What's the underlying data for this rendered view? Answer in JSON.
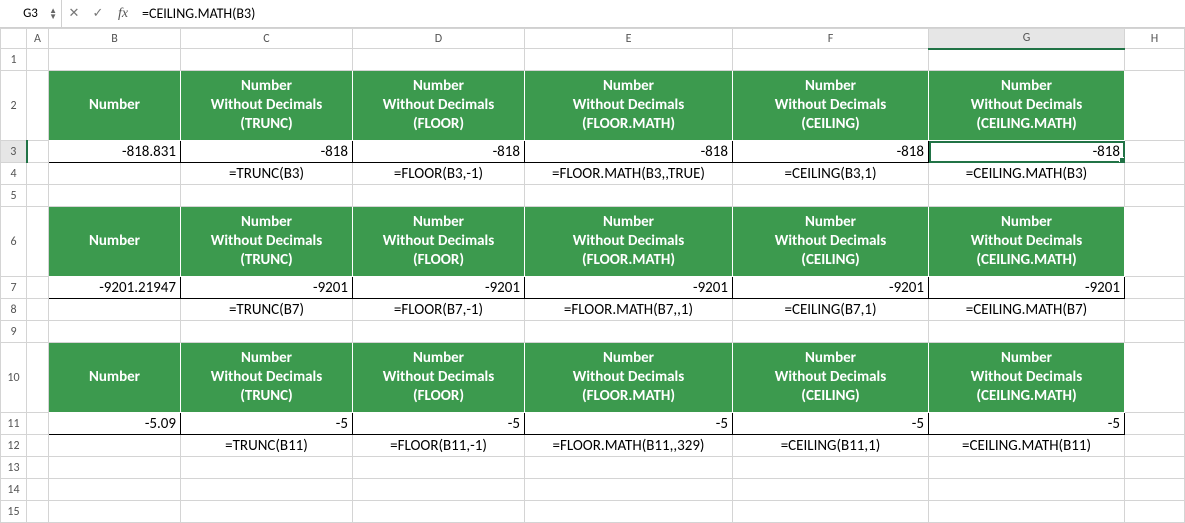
{
  "formula_bar": {
    "name_box": "G3",
    "cancel_glyph": "✕",
    "confirm_glyph": "✓",
    "fx_label": "fx",
    "formula": "=CEILING.MATH(B3)"
  },
  "columns": [
    "A",
    "B",
    "C",
    "D",
    "E",
    "F",
    "G",
    "H"
  ],
  "col_widths": {
    "rowhdr": 26,
    "A": 22,
    "B": 132,
    "C": 172,
    "D": 172,
    "E": 208,
    "F": 196,
    "G": 196,
    "H": 60
  },
  "rows": [
    "1",
    "2",
    "3",
    "4",
    "5",
    "6",
    "7",
    "8",
    "9",
    "10",
    "11",
    "12",
    "13",
    "14",
    "15"
  ],
  "selected_cell": "G3",
  "selected_col": "G",
  "selected_row": "3",
  "headers": {
    "number": "Number",
    "trunc": "Number\nWithout Decimals\n(TRUNC)",
    "floor": "Number\nWithout Decimals\n(FLOOR)",
    "floor_math": "Number\nWithout Decimals\n(FLOOR.MATH)",
    "ceiling": "Number\nWithout Decimals\n(CEILING)",
    "ceiling_math": "Number\nWithout Decimals\n(CEILING.MATH)"
  },
  "chart_data": {
    "type": "table",
    "blocks": [
      {
        "header_row": 2,
        "value_row": 3,
        "formula_row": 4,
        "number": "-818.831",
        "values": {
          "trunc": "-818",
          "floor": "-818",
          "floor_math": "-818",
          "ceiling": "-818",
          "ceiling_math": "-818"
        },
        "formulas": {
          "trunc": "=TRUNC(B3)",
          "floor": "=FLOOR(B3,-1)",
          "floor_math": "=FLOOR.MATH(B3,,TRUE)",
          "ceiling": "=CEILING(B3,1)",
          "ceiling_math": "=CEILING.MATH(B3)"
        }
      },
      {
        "header_row": 6,
        "value_row": 7,
        "formula_row": 8,
        "number": "-9201.21947",
        "values": {
          "trunc": "-9201",
          "floor": "-9201",
          "floor_math": "-9201",
          "ceiling": "-9201",
          "ceiling_math": "-9201"
        },
        "formulas": {
          "trunc": "=TRUNC(B7)",
          "floor": "=FLOOR(B7,-1)",
          "floor_math": "=FLOOR.MATH(B7,,1)",
          "ceiling": "=CEILING(B7,1)",
          "ceiling_math": "=CEILING.MATH(B7)"
        }
      },
      {
        "header_row": 10,
        "value_row": 11,
        "formula_row": 12,
        "number": "-5.09",
        "values": {
          "trunc": "-5",
          "floor": "-5",
          "floor_math": "-5",
          "ceiling": "-5",
          "ceiling_math": "-5"
        },
        "formulas": {
          "trunc": "=TRUNC(B11)",
          "floor": "=FLOOR(B11,-1)",
          "floor_math": "=FLOOR.MATH(B11,,329)",
          "ceiling": "=CEILING(B11,1)",
          "ceiling_math": "=CEILING.MATH(B11)"
        }
      }
    ]
  }
}
